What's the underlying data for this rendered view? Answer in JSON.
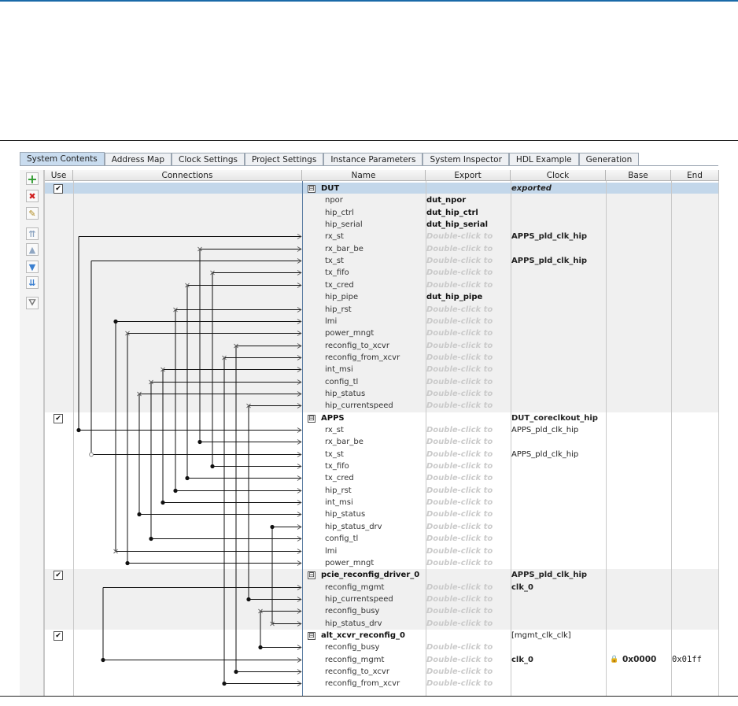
{
  "tabs": [
    "System Contents",
    "Address Map",
    "Clock Settings",
    "Project Settings",
    "Instance Parameters",
    "System Inspector",
    "HDL Example",
    "Generation"
  ],
  "active_tab": "System Contents",
  "columns": {
    "use": "Use",
    "connections": "Connections",
    "name": "Name",
    "export": "Export",
    "clock": "Clock",
    "base": "Base",
    "end": "End"
  },
  "toolbar": [
    {
      "icon": "add-icon",
      "glyph": "+"
    },
    {
      "icon": "remove-icon",
      "glyph": "✖"
    },
    {
      "icon": "edit-icon",
      "glyph": "✎"
    },
    {
      "icon": "move-top-icon",
      "glyph": "⇈"
    },
    {
      "icon": "move-up-icon",
      "glyph": "▲"
    },
    {
      "icon": "move-down-icon",
      "glyph": "▼"
    },
    {
      "icon": "move-bottom-icon",
      "glyph": "⇊"
    },
    {
      "icon": "filter-icon",
      "glyph": "⛛"
    }
  ],
  "colors": {
    "selected_row": "#c3d7ea",
    "active_tab": "#c9dcef",
    "add": "#2e9a2e",
    "remove": "#d02020",
    "move": "#3a7fd0"
  },
  "rows": [
    {
      "type": "group",
      "name": "DUT",
      "check": "✔",
      "expand": "⊟",
      "export": "",
      "clock": "exported",
      "clock_style": "bi",
      "selected": true
    },
    {
      "name": "npor",
      "export": "dut_npor"
    },
    {
      "name": "hip_ctrl",
      "export": "dut_hip_ctrl"
    },
    {
      "name": "hip_serial",
      "export": "dut_hip_serial"
    },
    {
      "name": "rx_st",
      "export": "Double-click to",
      "clock": "APPS_pld_clk_hip",
      "clock_style": "b"
    },
    {
      "name": "rx_bar_be",
      "export": "Double-click to"
    },
    {
      "name": "tx_st",
      "export": "Double-click to",
      "clock": "APPS_pld_clk_hip",
      "clock_style": "b"
    },
    {
      "name": "tx_fifo",
      "export": "Double-click to"
    },
    {
      "name": "tx_cred",
      "export": "Double-click to"
    },
    {
      "name": "hip_pipe",
      "export": "dut_hip_pipe"
    },
    {
      "name": "hip_rst",
      "export": "Double-click to"
    },
    {
      "name": "lmi",
      "export": "Double-click to"
    },
    {
      "name": "power_mngt",
      "export": "Double-click to"
    },
    {
      "name": "reconfig_to_xcvr",
      "export": "Double-click to"
    },
    {
      "name": "reconfig_from_xcvr",
      "export": "Double-click to"
    },
    {
      "name": "int_msi",
      "export": "Double-click to"
    },
    {
      "name": "config_tl",
      "export": "Double-click to"
    },
    {
      "name": "hip_status",
      "export": "Double-click to"
    },
    {
      "name": "hip_currentspeed",
      "export": "Double-click to"
    },
    {
      "type": "group",
      "name": "APPS",
      "check": "✔",
      "expand": "⊟",
      "export": "",
      "clock": "DUT_coreclkout_hip",
      "clock_style": "b"
    },
    {
      "name": "rx_st",
      "export": "Double-click to",
      "clock": "APPS_pld_clk_hip"
    },
    {
      "name": "rx_bar_be",
      "export": "Double-click to"
    },
    {
      "name": "tx_st",
      "export": "Double-click to",
      "clock": "APPS_pld_clk_hip"
    },
    {
      "name": "tx_fifo",
      "export": "Double-click to"
    },
    {
      "name": "tx_cred",
      "export": "Double-click to"
    },
    {
      "name": "hip_rst",
      "export": "Double-click to"
    },
    {
      "name": "int_msi",
      "export": "Double-click to"
    },
    {
      "name": "hip_status",
      "export": "Double-click to"
    },
    {
      "name": "hip_status_drv",
      "export": "Double-click to"
    },
    {
      "name": "config_tl",
      "export": "Double-click to"
    },
    {
      "name": "lmi",
      "export": "Double-click to"
    },
    {
      "name": "power_mngt",
      "export": "Double-click to"
    },
    {
      "type": "group",
      "name": "pcie_reconfig_driver_0",
      "check": "✔",
      "expand": "⊟",
      "export": "",
      "clock": "APPS_pld_clk_hip",
      "clock_style": "b"
    },
    {
      "name": "reconfig_mgmt",
      "export": "Double-click to",
      "clock": "clk_0",
      "clock_style": "b"
    },
    {
      "name": "hip_currentspeed",
      "export": "Double-click to"
    },
    {
      "name": "reconfig_busy",
      "export": "Double-click to"
    },
    {
      "name": "hip_status_drv",
      "export": "Double-click to"
    },
    {
      "type": "group",
      "name": "alt_xcvr_reconfig_0",
      "check": "✔",
      "expand": "⊟",
      "export": "",
      "clock": "[mgmt_clk_clk]"
    },
    {
      "name": "reconfig_busy",
      "export": "Double-click to"
    },
    {
      "name": "reconfig_mgmt",
      "export": "Double-click to",
      "clock": "clk_0",
      "clock_style": "b",
      "base": "0x0000",
      "end": "0x01ff",
      "lock": "🔒"
    },
    {
      "name": "reconfig_to_xcvr",
      "export": "Double-click to"
    },
    {
      "name": "reconfig_from_xcvr",
      "export": "Double-click to"
    }
  ]
}
